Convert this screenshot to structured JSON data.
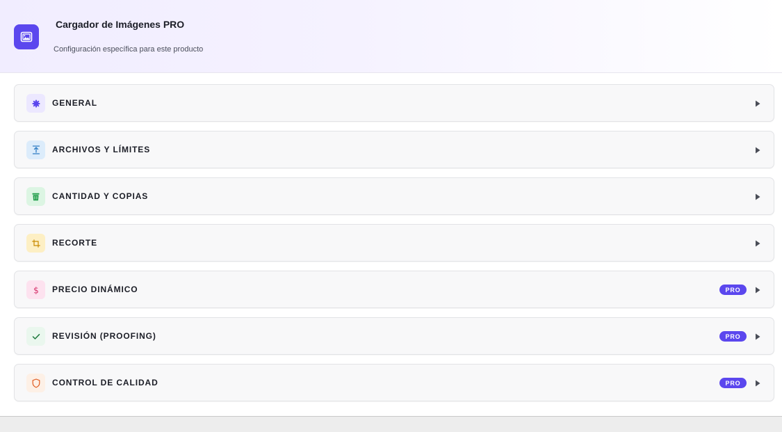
{
  "header": {
    "title": "Cargador de Imágenes PRO",
    "subtitle": "Configuración específica para este producto",
    "icon": "image-upload-icon",
    "accent_color": "#5b47ee"
  },
  "sections": [
    {
      "label": "GENERAL",
      "icon": "gear-icon",
      "icon_bg": "#ece8ff",
      "icon_color": "#5b47ee",
      "pro": false
    },
    {
      "label": "ARCHIVOS Y LÍMITES",
      "icon": "upload-icon",
      "icon_bg": "#dcecfb",
      "icon_color": "#2f7cc4",
      "pro": false
    },
    {
      "label": "CANTIDAD Y COPIAS",
      "icon": "copies-icon",
      "icon_bg": "#dcf5e3",
      "icon_color": "#1f9d4a",
      "pro": false
    },
    {
      "label": "RECORTE",
      "icon": "crop-icon",
      "icon_bg": "#fdefc4",
      "icon_color": "#c98a00",
      "pro": false
    },
    {
      "label": "PRECIO DINÁMICO",
      "icon": "dollar-icon",
      "icon_bg": "#fde2ef",
      "icon_color": "#d6336c",
      "pro": true,
      "badge": "PRO"
    },
    {
      "label": "REVISIÓN (PROOFING)",
      "icon": "check-icon",
      "icon_bg": "#eaf7ee",
      "icon_color": "#1f7a3e",
      "pro": true,
      "badge": "PRO"
    },
    {
      "label": "CONTROL DE CALIDAD",
      "icon": "shield-icon",
      "icon_bg": "#fdf0e6",
      "icon_color": "#e05a1f",
      "pro": true,
      "badge": "PRO"
    }
  ]
}
